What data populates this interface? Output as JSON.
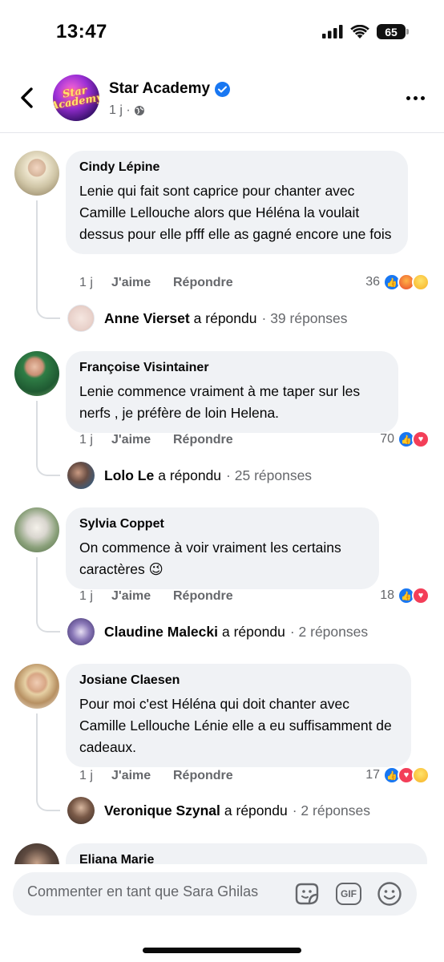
{
  "status_bar": {
    "time": "13:47",
    "battery": "65"
  },
  "header": {
    "page_name": "Star Academy",
    "logo_text": "Star Academy",
    "meta": "1 j ·"
  },
  "comments": [
    {
      "author": "Cindy Lépine",
      "text": "Lenie qui fait sont caprice pour chanter avec Camille Lellouche alors que Héléna la voulait dessus pour elle pfff elle as gagné encore une fois",
      "age": "1 j",
      "like_label": "J'aime",
      "reply_label": "Répondre",
      "reaction_count": "36",
      "reactions": [
        "like",
        "angry",
        "care"
      ],
      "reply_author": "Anne Vierset",
      "reply_verb": "a répondu",
      "reply_count": "· 39 réponses"
    },
    {
      "author": "Françoise Visintainer",
      "text": "Lenie commence vraiment à me taper sur les nerfs , je préfère de loin  Helena.",
      "age": "1 j",
      "like_label": "J'aime",
      "reply_label": "Répondre",
      "reaction_count": "70",
      "reactions": [
        "like",
        "love"
      ],
      "reply_author": "Lolo Le",
      "reply_verb": "a répondu",
      "reply_count": "· 25 réponses"
    },
    {
      "author": "Sylvia Coppet",
      "text": "On commence à voir vraiment les certains caractères 😉",
      "age": "1 j",
      "like_label": "J'aime",
      "reply_label": "Répondre",
      "reaction_count": "18",
      "reactions": [
        "like",
        "love"
      ],
      "reply_author": "Claudine Malecki",
      "reply_verb": "a répondu",
      "reply_count": "· 2 réponses"
    },
    {
      "author": "Josiane Claesen",
      "text": "Pour moi  c'est Héléna qui doit chanter avec Camille Lellouche Lénie elle a eu suffisamment de cadeaux.",
      "age": "1 j",
      "like_label": "J'aime",
      "reply_label": "Répondre",
      "reaction_count": "17",
      "reactions": [
        "like",
        "love",
        "care"
      ],
      "reply_author": "Veronique Szynal",
      "reply_verb": "a répondu",
      "reply_count": "· 2 réponses"
    },
    {
      "author": "Eliana Marie"
    }
  ],
  "composer": {
    "placeholder": "Commenter en tant que Sara Ghilas",
    "gif_label": "GIF"
  },
  "colors": {
    "accent": "#1877f2",
    "bubble": "#f0f2f5",
    "secondary_text": "#65676b"
  }
}
